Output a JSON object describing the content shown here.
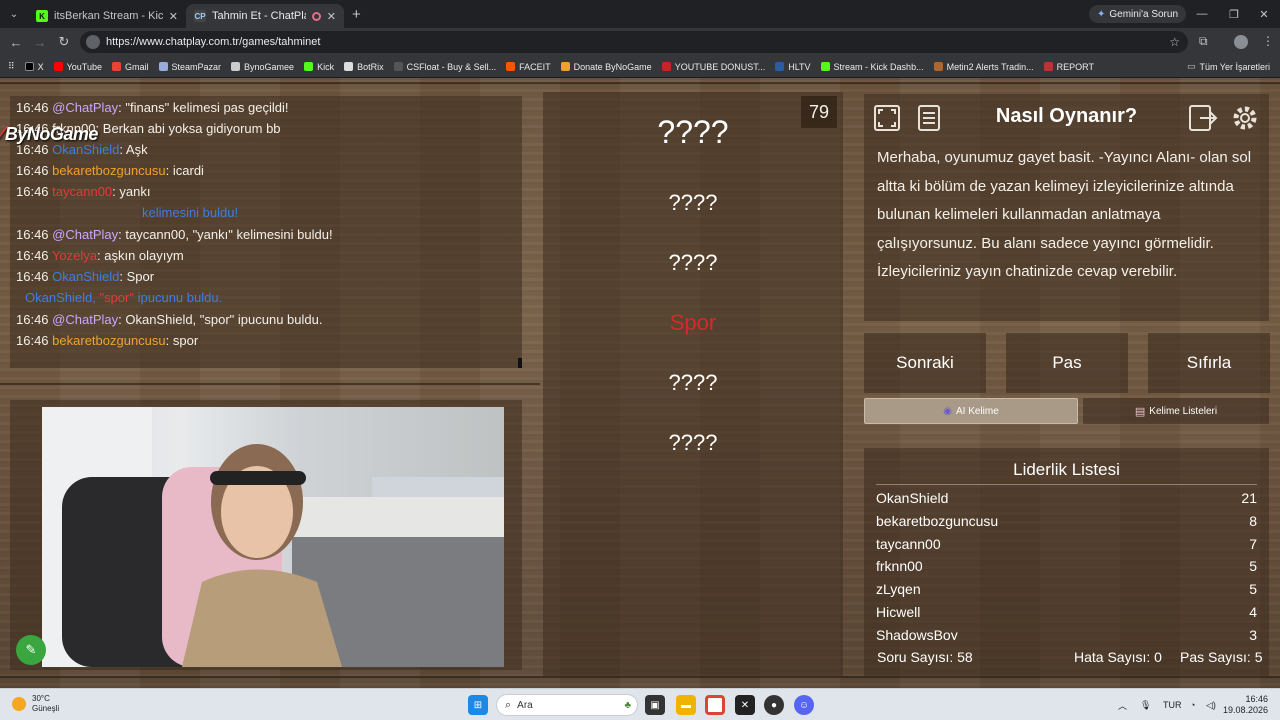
{
  "browser": {
    "tabs": [
      {
        "title": "itsBerkan Stream - Kick Dashbo",
        "favicon": "kick-green"
      },
      {
        "title": "Tahmin Et - ChatPlay",
        "favicon": "chatplay"
      }
    ],
    "new_tab": "+",
    "gemini_button": "Gemini'a Sorun",
    "url": "https://www.chatplay.com.tr/games/tahminet",
    "bookmarks": [
      "X",
      "YouTube",
      "Gmail",
      "SteamPazar",
      "BynoGamee",
      "Kick",
      "BotRix",
      "CSFloat - Buy & Sell...",
      "FACEIT",
      "Donate ByNoGame",
      "YOUTUBE DONUST...",
      "HLTV",
      "Stream - Kick Dashb...",
      "Metin2 Alerts Tradin...",
      "REPORT"
    ],
    "all_bookmarks": "Tüm Yer İşaretleri"
  },
  "chat": {
    "lines": [
      {
        "ts": "16:46",
        "user": "@ChatPlay",
        "user_color": "#caa6ff",
        "msg": ": \"finans\" kelimesi pas geçildi!"
      },
      {
        "ts": "16:46",
        "user": "frknn00",
        "user_color": "#f3f0ea",
        "msg": ": Berkan abi yoksa gidiyorum bb"
      },
      {
        "ts": "16:46",
        "user": "OkanShield",
        "user_color": "#3d7fe0",
        "msg": ": Aşk"
      },
      {
        "ts": "16:46",
        "user": "bekaretbozguncusu",
        "user_color": "#f0a030",
        "msg": ": icardi"
      },
      {
        "ts": "16:46",
        "user": "taycann00",
        "user_color": "#e23b3b",
        "msg": ": yankı"
      },
      {
        "ts": "",
        "user": "",
        "user_color": "#3d7fe0",
        "msg": "kelimesini buldu!"
      },
      {
        "ts": "16:46",
        "user": "@ChatPlay",
        "user_color": "#caa6ff",
        "msg": ": taycann00, \"yankı\" kelimesini buldu!"
      },
      {
        "ts": "16:46",
        "user": "Yozelya",
        "user_color": "#e23b3b",
        "msg": ": aşkın olayıym"
      },
      {
        "ts": "16:46",
        "user": "OkanShield",
        "user_color": "#3d7fe0",
        "msg": ": Spor"
      },
      {
        "ts": "",
        "user": "OkanShield,",
        "user_color": "#3d7fe0",
        "msg": "ipucunu buldu.",
        "extra": "\"spor\""
      },
      {
        "ts": "16:46",
        "user": "@ChatPlay",
        "user_color": "#caa6ff",
        "msg": ": OkanShield, \"spor\" ipucunu buldu."
      },
      {
        "ts": "16:46",
        "user": "bekaretbozguncusu",
        "user_color": "#f0a030",
        "msg": ": spor"
      }
    ],
    "brand_overlay": "ByNoGame"
  },
  "game": {
    "timer": "79",
    "words": [
      {
        "text": "????",
        "state": "hidden",
        "size": "big"
      },
      {
        "text": "????",
        "state": "hidden",
        "size": "small"
      },
      {
        "text": "????",
        "state": "hidden",
        "size": "small"
      },
      {
        "text": "Spor",
        "state": "found",
        "size": "small"
      },
      {
        "text": "????",
        "state": "hidden",
        "size": "small"
      },
      {
        "text": "????",
        "state": "hidden",
        "size": "small"
      }
    ]
  },
  "info": {
    "title": "Nasıl Oynanır?",
    "text": "Merhaba, oyunumuz gayet basit. -Yayıncı Alanı- olan sol altta ki bölüm de yazan kelimeyi izleyicilerinize altında bulunan kelimeleri kullanmadan anlatmaya çalışıyorsunuz. Bu alanı sadece yayıncı görmelidir. İzleyicileriniz yayın chatinizde cevap verebilir."
  },
  "controls": {
    "next": "Sonraki",
    "pass": "Pas",
    "reset": "Sıfırla",
    "tab_ai": "AI Kelime",
    "tab_lists": "Kelime Listeleri"
  },
  "leaderboard": {
    "title": "Liderlik Listesi",
    "rows": [
      {
        "name": "OkanShield",
        "score": "21"
      },
      {
        "name": "bekaretbozguncusu",
        "score": "8"
      },
      {
        "name": "taycann00",
        "score": "7"
      },
      {
        "name": "frknn00",
        "score": "5"
      },
      {
        "name": "zLyqen",
        "score": "5"
      },
      {
        "name": "Hicwell",
        "score": "4"
      },
      {
        "name": "ShadowsBoy",
        "score": "3"
      }
    ]
  },
  "stats": {
    "questions": "Soru Sayısı: 58",
    "errors": "Hata Sayısı: 0",
    "passes": "Pas Sayısı: 5"
  },
  "taskbar": {
    "temp": "30°C",
    "weather": "Güneşli",
    "search": "Ara",
    "lang": "TUR",
    "time": "16:46",
    "date": "19.08.2026"
  }
}
